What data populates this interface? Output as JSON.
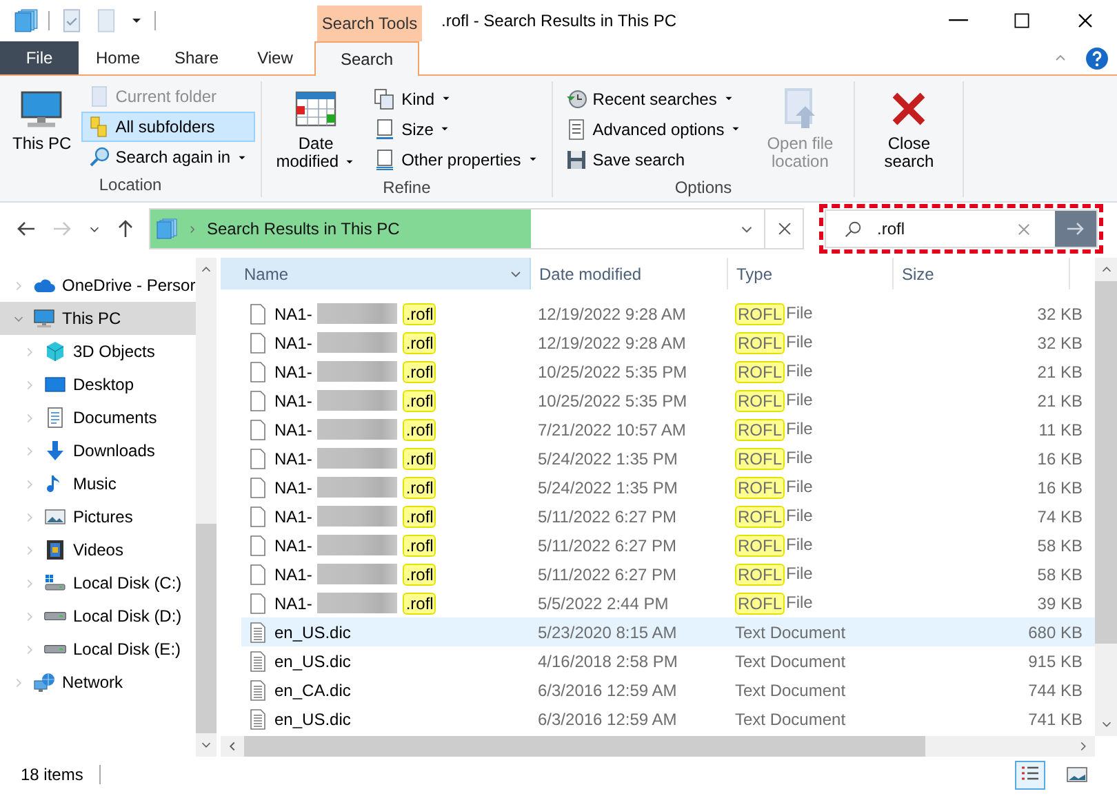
{
  "title_bar": {
    "context_tab": "Search Tools",
    "title": ".rofl - Search Results in This PC"
  },
  "tabs": [
    {
      "label": "File",
      "kind": "file",
      "selected": false
    },
    {
      "label": "Home",
      "kind": "plain",
      "selected": false
    },
    {
      "label": "Share",
      "kind": "plain",
      "selected": false
    },
    {
      "label": "View",
      "kind": "plain",
      "selected": false
    },
    {
      "label": "Search",
      "kind": "context",
      "selected": true
    }
  ],
  "ribbon": [
    {
      "label": "Location",
      "columns": [
        {
          "kind": "large",
          "buttons": [
            {
              "label": "This PC",
              "kind": "pc",
              "dropdown": false,
              "disabled": false,
              "selected": false
            }
          ]
        },
        {
          "kind": "stack",
          "buttons": [
            {
              "label": "Current folder",
              "kind": "folder",
              "dropdown": false,
              "disabled": true,
              "selected": false
            },
            {
              "label": "All subfolders",
              "kind": "subfolders",
              "dropdown": false,
              "disabled": false,
              "selected": true
            },
            {
              "label": "Search again in",
              "kind": "searchagain",
              "dropdown": true,
              "disabled": false,
              "selected": false
            }
          ]
        }
      ]
    },
    {
      "label": "Refine",
      "columns": [
        {
          "kind": "large",
          "buttons": [
            {
              "label": "Date modified",
              "kind": "calendar",
              "dropdown": true,
              "disabled": false,
              "selected": false
            }
          ]
        },
        {
          "kind": "stack",
          "buttons": [
            {
              "label": "Kind",
              "kind": "kind",
              "dropdown": true,
              "disabled": false,
              "selected": false
            },
            {
              "label": "Size",
              "kind": "size",
              "dropdown": true,
              "disabled": false,
              "selected": false
            },
            {
              "label": "Other properties",
              "kind": "properties",
              "dropdown": true,
              "disabled": false,
              "selected": false
            }
          ]
        }
      ]
    },
    {
      "label": "Options",
      "columns": [
        {
          "kind": "stack",
          "buttons": [
            {
              "label": "Recent searches",
              "kind": "recent",
              "dropdown": true,
              "disabled": false,
              "selected": false
            },
            {
              "label": "Advanced options",
              "kind": "advanced",
              "dropdown": true,
              "disabled": false,
              "selected": false
            },
            {
              "label": "Save search",
              "kind": "save",
              "dropdown": false,
              "disabled": false,
              "selected": false
            }
          ]
        },
        {
          "kind": "large",
          "buttons": [
            {
              "label": "Open file location",
              "kind": "openlocation",
              "dropdown": false,
              "disabled": true,
              "selected": false
            }
          ]
        }
      ]
    },
    {
      "columns": [
        {
          "kind": "large",
          "buttons": [
            {
              "label": "Close search",
              "kind": "close",
              "dropdown": false,
              "disabled": false,
              "selected": false
            }
          ]
        }
      ]
    }
  ],
  "nav_buttons": [
    {
      "kind": "back",
      "disabled": false
    },
    {
      "kind": "forward",
      "disabled": true
    },
    {
      "kind": "recent",
      "disabled": false
    },
    {
      "kind": "up",
      "disabled": false
    }
  ],
  "address": {
    "path": "Search Results in This PC",
    "level": 0.62
  },
  "search": {
    "value": ".rofl"
  },
  "sidebar": [
    {
      "label": "OneDrive - Persor",
      "kind": "cloud",
      "expanded": false,
      "selected": false
    },
    {
      "label": "This PC",
      "kind": "pc",
      "expanded": true,
      "selected": true,
      "children": [
        {
          "label": "3D Objects",
          "kind": "cube",
          "expanded": false,
          "selected": false
        },
        {
          "label": "Desktop",
          "kind": "desktop",
          "expanded": false,
          "selected": false
        },
        {
          "label": "Documents",
          "kind": "documents",
          "expanded": false,
          "selected": false
        },
        {
          "label": "Downloads",
          "kind": "downloads",
          "expanded": false,
          "selected": false
        },
        {
          "label": "Music",
          "kind": "music",
          "expanded": false,
          "selected": false
        },
        {
          "label": "Pictures",
          "kind": "pictures",
          "expanded": false,
          "selected": false
        },
        {
          "label": "Videos",
          "kind": "videos",
          "expanded": false,
          "selected": false
        },
        {
          "label": "Local Disk (C:)",
          "kind": "sysdisk",
          "expanded": false,
          "selected": false
        },
        {
          "label": "Local Disk (D:)",
          "kind": "disk",
          "expanded": false,
          "selected": false
        },
        {
          "label": "Local Disk (E:)",
          "kind": "disk",
          "expanded": false,
          "selected": false
        }
      ]
    },
    {
      "label": "Network",
      "kind": "network",
      "expanded": false,
      "selected": false
    }
  ],
  "table": {
    "columns": [
      {
        "label": "Name",
        "highlighted": true
      },
      {
        "label": "Date modified",
        "highlighted": false
      },
      {
        "label": "Type",
        "highlighted": false
      },
      {
        "label": "Size",
        "highlighted": false
      }
    ],
    "rows": [
      {
        "kind": "match",
        "name": "NA1-",
        "redacted": true,
        "match": ".rofl",
        "date": "12/19/2022 9:28 AM",
        "type_match": "ROFL",
        "type": "File",
        "size": "32 KB",
        "selected": false
      },
      {
        "kind": "match",
        "name": "NA1-",
        "redacted": true,
        "match": ".rofl",
        "date": "12/19/2022 9:28 AM",
        "type_match": "ROFL",
        "type": "File",
        "size": "32 KB",
        "selected": false
      },
      {
        "kind": "match",
        "name": "NA1-",
        "redacted": true,
        "match": ".rofl",
        "date": "10/25/2022 5:35 PM",
        "type_match": "ROFL",
        "type": "File",
        "size": "21 KB",
        "selected": false
      },
      {
        "kind": "match",
        "name": "NA1-",
        "redacted": true,
        "match": ".rofl",
        "date": "10/25/2022 5:35 PM",
        "type_match": "ROFL",
        "type": "File",
        "size": "21 KB",
        "selected": false
      },
      {
        "kind": "match",
        "name": "NA1-",
        "redacted": true,
        "match": ".rofl",
        "date": "7/21/2022 10:57 AM",
        "type_match": "ROFL",
        "type": "File",
        "size": "11 KB",
        "selected": false
      },
      {
        "kind": "match",
        "name": "NA1-",
        "redacted": true,
        "match": ".rofl",
        "date": "5/24/2022 1:35 PM",
        "type_match": "ROFL",
        "type": "File",
        "size": "16 KB",
        "selected": false
      },
      {
        "kind": "match",
        "name": "NA1-",
        "redacted": true,
        "match": ".rofl",
        "date": "5/24/2022 1:35 PM",
        "type_match": "ROFL",
        "type": "File",
        "size": "16 KB",
        "selected": false
      },
      {
        "kind": "match",
        "name": "NA1-",
        "redacted": true,
        "match": ".rofl",
        "date": "5/11/2022 6:27 PM",
        "type_match": "ROFL",
        "type": "File",
        "size": "74 KB",
        "selected": false
      },
      {
        "kind": "match",
        "name": "NA1-",
        "redacted": true,
        "match": ".rofl",
        "date": "5/11/2022 6:27 PM",
        "type_match": "ROFL",
        "type": "File",
        "size": "58 KB",
        "selected": false
      },
      {
        "kind": "match",
        "name": "NA1-",
        "redacted": true,
        "match": ".rofl",
        "date": "5/11/2022 6:27 PM",
        "type_match": "ROFL",
        "type": "File",
        "size": "58 KB",
        "selected": false
      },
      {
        "kind": "match",
        "name": "NA1-",
        "redacted": true,
        "match": ".rofl",
        "date": "5/5/2022 2:44 PM",
        "type_match": "ROFL",
        "type": "File",
        "size": "39 KB",
        "selected": false
      },
      {
        "kind": "text",
        "name": "en_US.dic",
        "redacted": false,
        "date": "5/23/2020 8:15 AM",
        "type": "Text Document",
        "size": "680 KB",
        "selected": true
      },
      {
        "kind": "text",
        "name": "en_US.dic",
        "redacted": false,
        "date": "4/16/2018 2:58 PM",
        "type": "Text Document",
        "size": "915 KB",
        "selected": false
      },
      {
        "kind": "text",
        "name": "en_CA.dic",
        "redacted": false,
        "date": "6/3/2016 12:59 AM",
        "type": "Text Document",
        "size": "744 KB",
        "selected": false
      },
      {
        "kind": "text",
        "name": "en_US.dic",
        "redacted": false,
        "date": "6/3/2016 12:59 AM",
        "type": "Text Document",
        "size": "741 KB",
        "selected": false
      }
    ]
  },
  "status_bar": {
    "count": "18 items",
    "views": [
      {
        "kind": "details",
        "selected": true
      },
      {
        "kind": "tiles",
        "selected": false
      }
    ]
  }
}
